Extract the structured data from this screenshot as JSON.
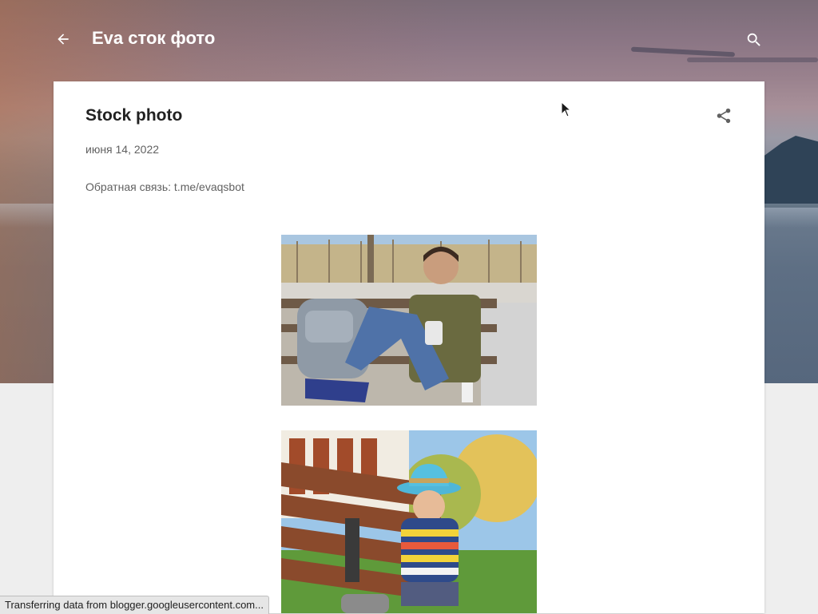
{
  "header": {
    "blog_title": "Eva сток фото",
    "back_icon": "arrow-back-icon",
    "search_icon": "search-icon"
  },
  "post": {
    "title": "Stock photo",
    "date": "июня 14, 2022",
    "feedback": "Обратная связь: t.me/evaqsbot",
    "share_icon": "share-icon",
    "images": [
      {
        "name": "photo-boy-on-bench-with-backpack"
      },
      {
        "name": "photo-child-in-blue-hat-on-bench"
      }
    ]
  },
  "status_bar": {
    "text": "Transferring data from blogger.googleusercontent.com..."
  },
  "colors": {
    "page_bg": "#eeeeee",
    "card_bg": "#ffffff",
    "title_text": "#212121",
    "meta_text": "#616161"
  }
}
